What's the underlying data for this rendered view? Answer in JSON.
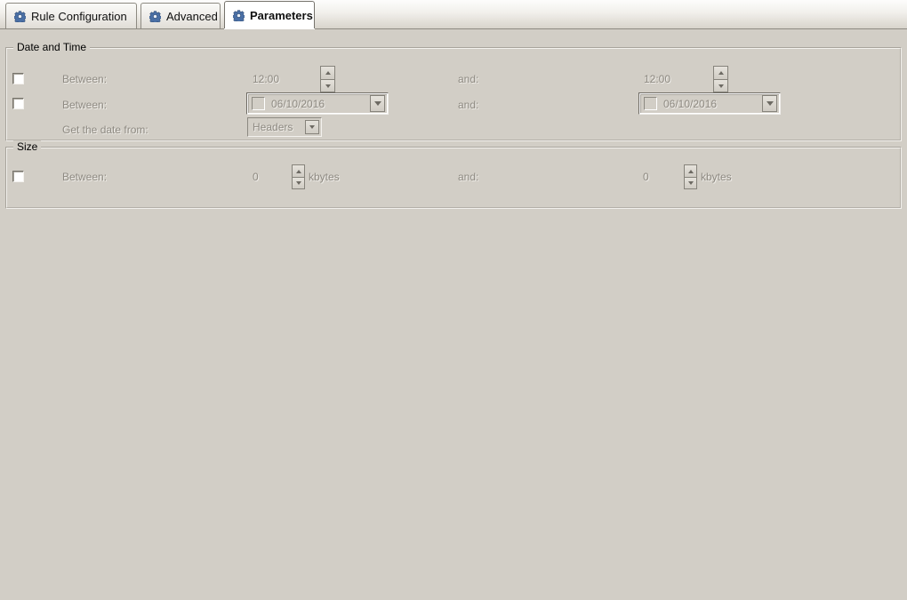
{
  "window": {
    "background_color": "#d2cec6"
  },
  "tabs": [
    {
      "label": "Rule Configuration",
      "icon": "gear-icon",
      "active": false
    },
    {
      "label": "Advanced",
      "icon": "gear-icon",
      "active": false
    },
    {
      "label": "Parameters",
      "icon": "gear-icon",
      "active": true
    }
  ],
  "groups": {
    "datetime": {
      "title": "Date and Time",
      "time_row": {
        "between_label": "Between:",
        "from_value": "12:00",
        "and_label": "and:",
        "to_value": "12:00",
        "checkbox_checked": false
      },
      "date_row": {
        "between_label": "Between:",
        "from_value": "06/10/2016",
        "and_label": "and:",
        "to_value": "06/10/2016",
        "checkbox_checked": false
      },
      "source_row": {
        "label": "Get the date from:",
        "selected": "Headers"
      }
    },
    "size": {
      "title": "Size",
      "row": {
        "between_label": "Between:",
        "from_value": "0",
        "from_unit": "kbytes",
        "and_label": "and:",
        "to_value": "0",
        "to_unit": "kbytes",
        "checkbox_checked": false
      }
    }
  }
}
